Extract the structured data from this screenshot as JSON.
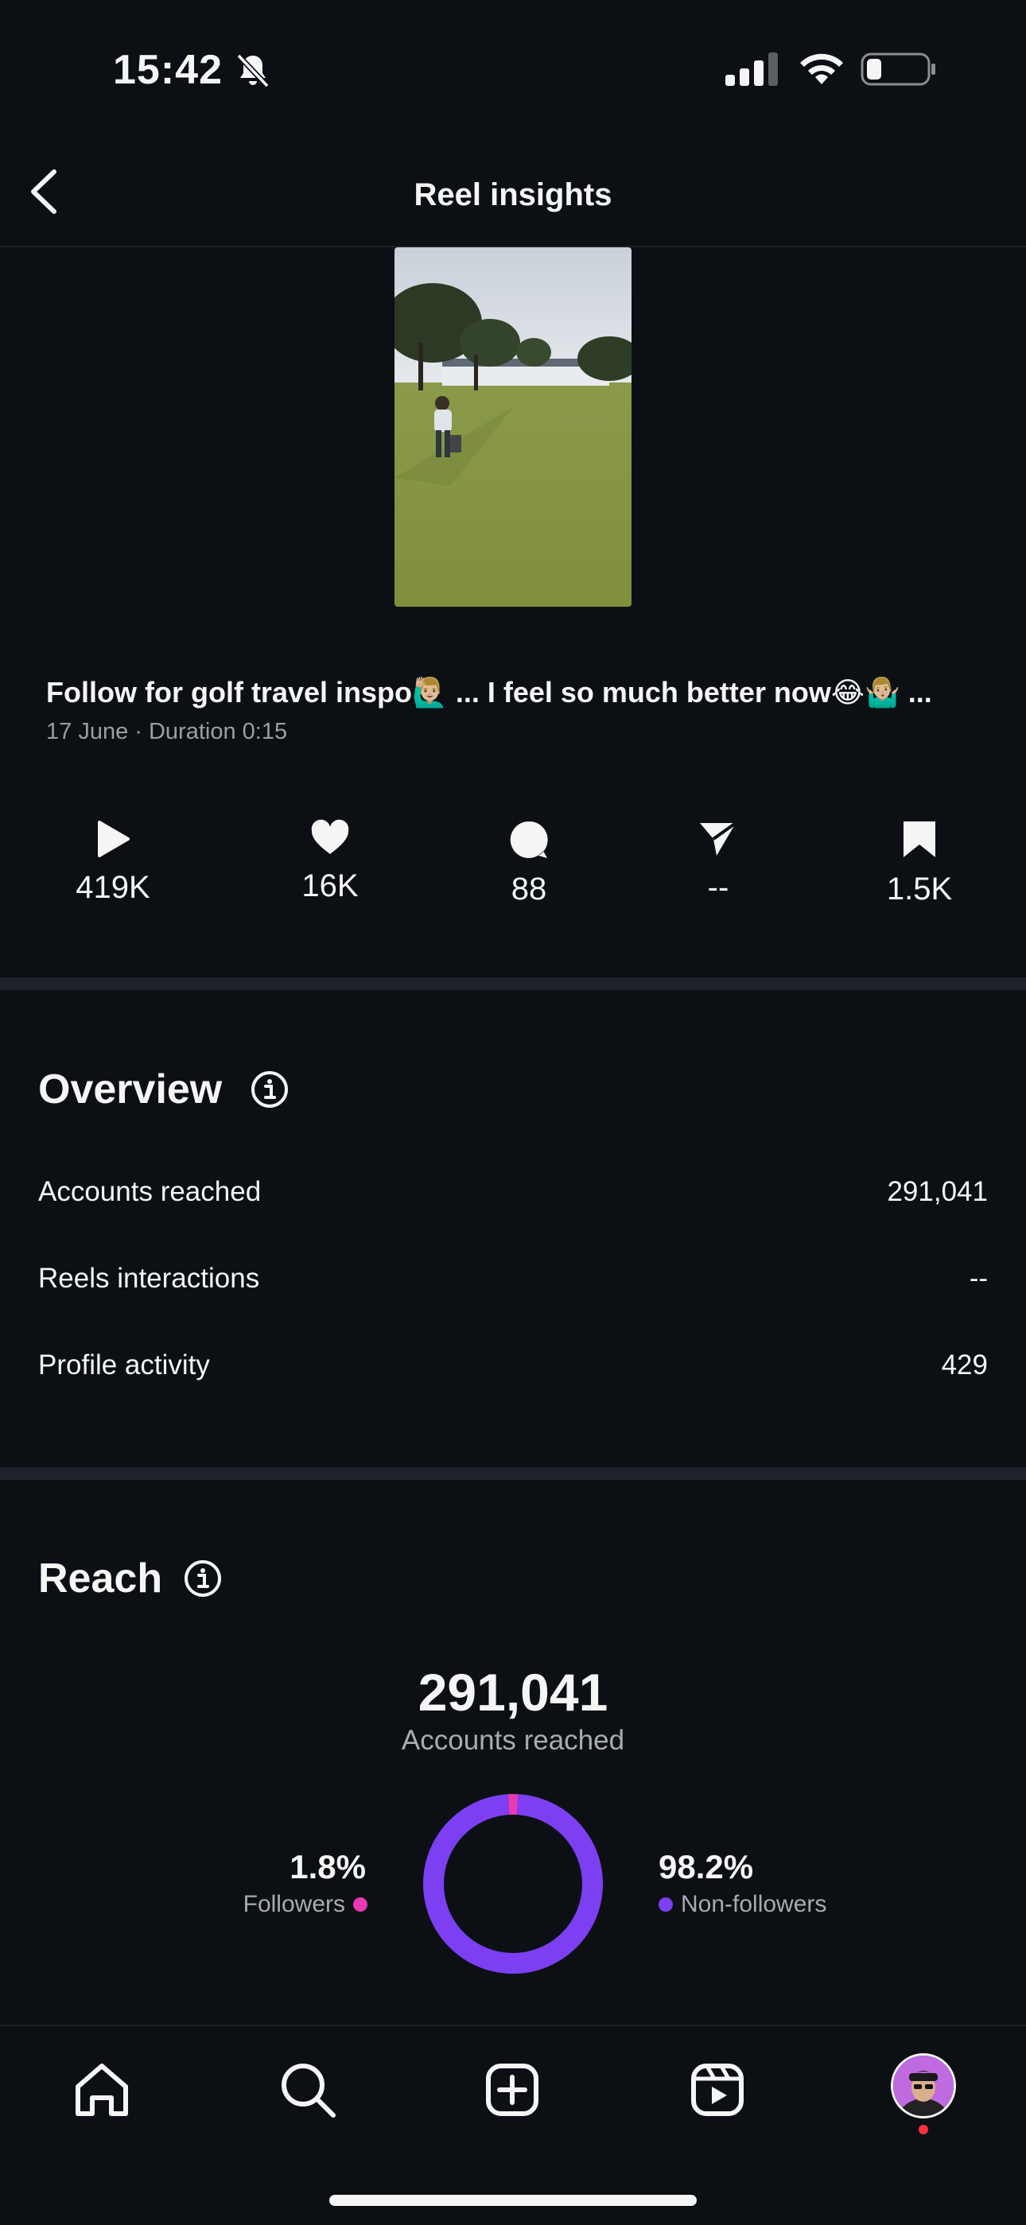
{
  "status_bar": {
    "time": "15:42",
    "icons": [
      "bell-off-icon",
      "signal-icon",
      "wifi-icon",
      "battery-icon"
    ]
  },
  "header": {
    "title": "Reel insights",
    "back_icon": "chevron-left-icon"
  },
  "reel": {
    "caption": "Follow for golf travel inspo🙋🏼‍♂️ ... I feel so much better now😂🤷🏼‍♂️ ...",
    "meta": "17 June · Duration 0:15"
  },
  "stats": [
    {
      "icon": "play-icon",
      "value": "419K"
    },
    {
      "icon": "heart-icon",
      "value": "16K"
    },
    {
      "icon": "comment-icon",
      "value": "88"
    },
    {
      "icon": "share-icon",
      "value": "--"
    },
    {
      "icon": "bookmark-icon",
      "value": "1.5K"
    }
  ],
  "overview": {
    "title": "Overview",
    "rows": [
      {
        "label": "Accounts reached",
        "value": "291,041"
      },
      {
        "label": "Reels interactions",
        "value": "--"
      },
      {
        "label": "Profile activity",
        "value": "429"
      }
    ]
  },
  "reach": {
    "title": "Reach",
    "total": "291,041",
    "total_label": "Accounts reached",
    "followers": {
      "percent": "1.8%",
      "label": "Followers",
      "color": "#e83ab5",
      "fraction": 0.018
    },
    "non_followers": {
      "percent": "98.2%",
      "label": "Non-followers",
      "color": "#7c3ff2",
      "fraction": 0.982
    }
  },
  "nav": {
    "items": [
      "home-icon",
      "search-icon",
      "create-icon",
      "reels-icon",
      "profile-avatar"
    ],
    "notification_color": "#ff3040"
  },
  "colors": {
    "background": "#0c1014",
    "text": "#f5f5f5",
    "muted": "#a8acb0"
  }
}
